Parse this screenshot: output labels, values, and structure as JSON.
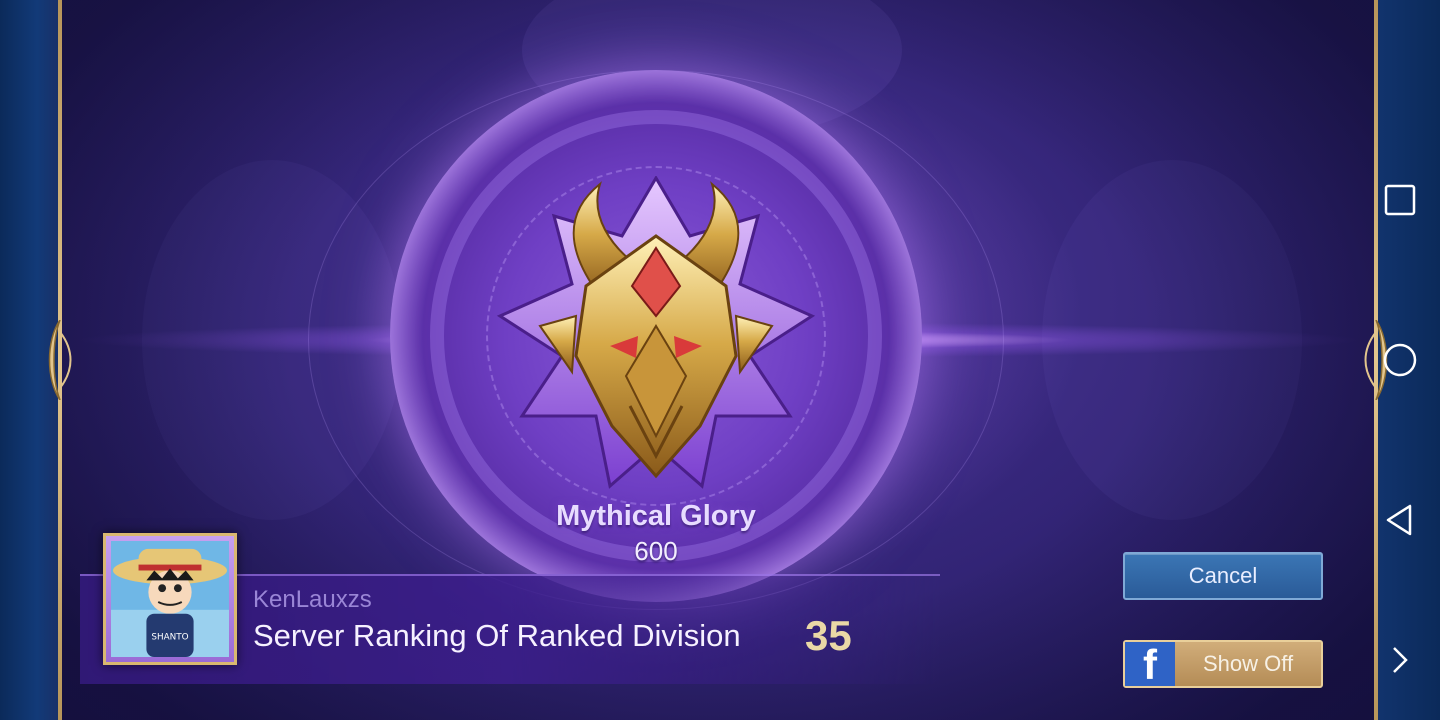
{
  "rank": {
    "title": "Mythical Glory",
    "points": "600"
  },
  "player": {
    "username": "KenLauxzs",
    "ranking_label": "Server Ranking Of Ranked Division",
    "ranking_value": "35"
  },
  "buttons": {
    "cancel_label": "Cancel",
    "showoff_label": "Show Off",
    "facebook_glyph": "f"
  },
  "nav": {
    "icons": [
      "square-icon",
      "circle-icon",
      "back-triangle-icon",
      "chevron-right-icon"
    ]
  },
  "colors": {
    "scene_purple": "#35267a",
    "gold": "#d9b870",
    "cancel_blue": "#2a5b98",
    "showoff_tan": "#b48c56",
    "facebook_blue": "#2f63c6"
  }
}
